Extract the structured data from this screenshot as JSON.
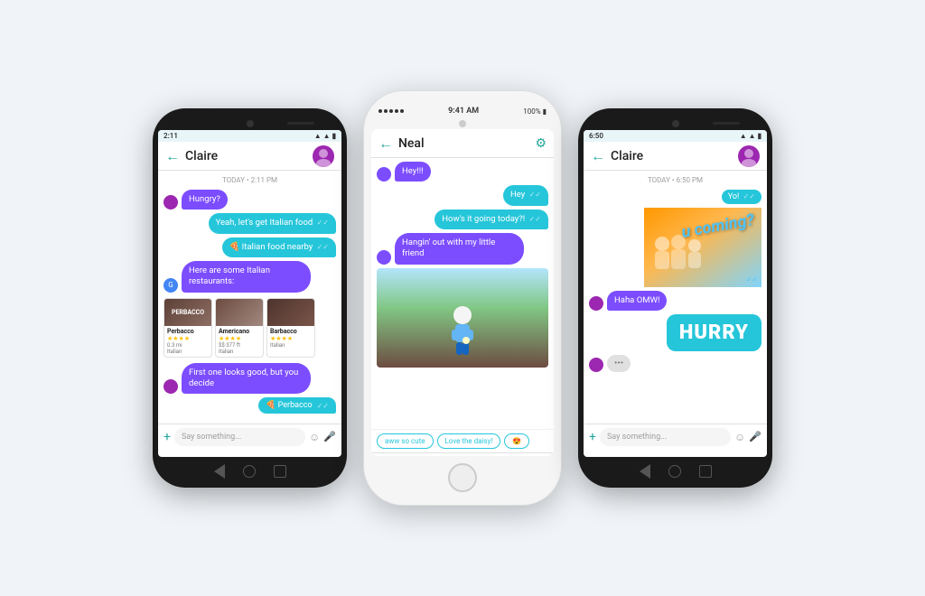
{
  "phone1": {
    "status_time": "2:11",
    "contact": "Claire",
    "date_divider": "TODAY • 2:11 PM",
    "messages": [
      {
        "type": "incoming",
        "text": "Hungry?"
      },
      {
        "type": "outgoing",
        "text": "Yeah, let's get Italian food"
      },
      {
        "type": "outgoing",
        "text": "🍕 Italian food nearby"
      },
      {
        "type": "google",
        "text": "Here are some Italian restaurants:"
      },
      {
        "type": "incoming",
        "text": "First one looks good, but you decide"
      },
      {
        "type": "outgoing-perbacco",
        "text": "Perbacco"
      }
    ],
    "restaurants": [
      {
        "name": "Perbacco",
        "stars": "★★★★",
        "detail": "0.3 mi",
        "type": "Italian",
        "style": "perbacco"
      },
      {
        "name": "Americano",
        "stars": "★★★★",
        "detail": "$$· 377 ft",
        "type": "Italian",
        "style": "americano"
      },
      {
        "name": "Barbacco",
        "stars": "★★★★",
        "detail": "",
        "type": "Italian",
        "style": "barbacco"
      }
    ],
    "input_placeholder": "Say something..."
  },
  "phone2": {
    "status_time": "9:41 AM",
    "status_battery": "100%",
    "contact": "Neal",
    "messages": [
      {
        "type": "incoming",
        "text": "Hey!!!"
      },
      {
        "type": "outgoing",
        "text": "Hey"
      },
      {
        "type": "outgoing",
        "text": "How's it going today?!"
      },
      {
        "type": "incoming",
        "text": "Hangin' out with my little friend"
      }
    ],
    "chips": [
      "aww so cute",
      "Love the daisy!",
      "😍"
    ],
    "input_placeholder": ""
  },
  "phone3": {
    "status_time": "6:50",
    "contact": "Claire",
    "date_divider": "TODAY • 6:50 PM",
    "messages": [
      {
        "type": "outgoing-yo",
        "text": "Yo!"
      },
      {
        "type": "photo",
        "text": "u coming?"
      },
      {
        "type": "incoming",
        "text": "Haha OMW!"
      },
      {
        "type": "outgoing-hurry",
        "text": "HURRY"
      },
      {
        "type": "dots",
        "text": "•••"
      }
    ],
    "input_placeholder": "Say something..."
  },
  "colors": {
    "teal": "#26c6da",
    "purple": "#7c4dff",
    "bg": "#f0f4f8"
  }
}
